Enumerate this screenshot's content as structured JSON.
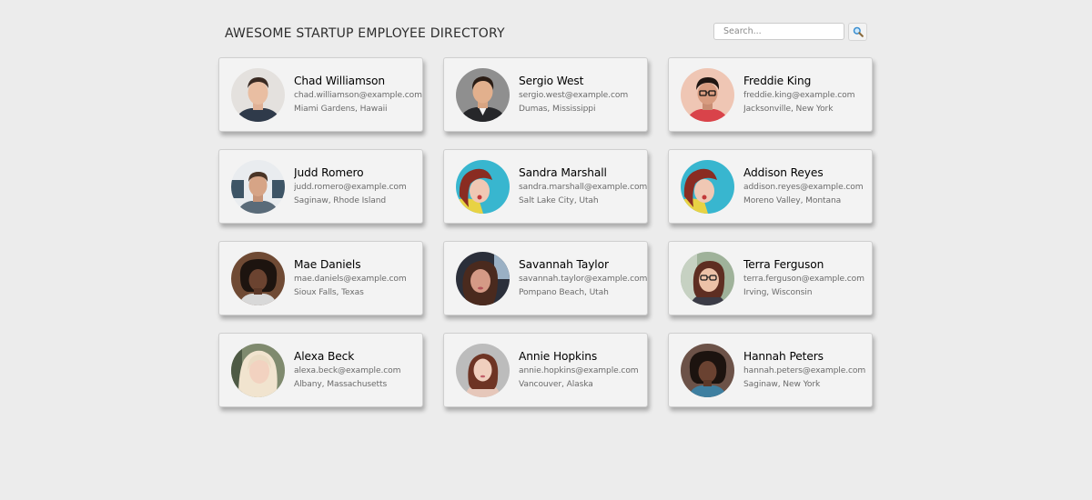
{
  "header": {
    "title": "AWESOME STARTUP EMPLOYEE DIRECTORY"
  },
  "search": {
    "placeholder": "Search...",
    "value": "",
    "button_icon": "magnifier-icon"
  },
  "employees": [
    {
      "name": "Chad Williamson",
      "email": "chad.williamson@example.com",
      "location": "Miami Gardens, Hawaii"
    },
    {
      "name": "Sergio West",
      "email": "sergio.west@example.com",
      "location": "Dumas, Mississippi"
    },
    {
      "name": "Freddie King",
      "email": "freddie.king@example.com",
      "location": "Jacksonville, New York"
    },
    {
      "name": "Judd Romero",
      "email": "judd.romero@example.com",
      "location": "Saginaw, Rhode Island"
    },
    {
      "name": "Sandra Marshall",
      "email": "sandra.marshall@example.com",
      "location": "Salt Lake City, Utah"
    },
    {
      "name": "Addison Reyes",
      "email": "addison.reyes@example.com",
      "location": "Moreno Valley, Montana"
    },
    {
      "name": "Mae Daniels",
      "email": "mae.daniels@example.com",
      "location": "Sioux Falls, Texas"
    },
    {
      "name": "Savannah Taylor",
      "email": "savannah.taylor@example.com",
      "location": "Pompano Beach, Utah"
    },
    {
      "name": "Terra Ferguson",
      "email": "terra.ferguson@example.com",
      "location": "Irving, Wisconsin"
    },
    {
      "name": "Alexa Beck",
      "email": "alexa.beck@example.com",
      "location": "Albany, Massachusetts"
    },
    {
      "name": "Annie Hopkins",
      "email": "annie.hopkins@example.com",
      "location": "Vancouver, Alaska"
    },
    {
      "name": "Hannah Peters",
      "email": "hannah.peters@example.com",
      "location": "Saginaw, New York"
    }
  ]
}
